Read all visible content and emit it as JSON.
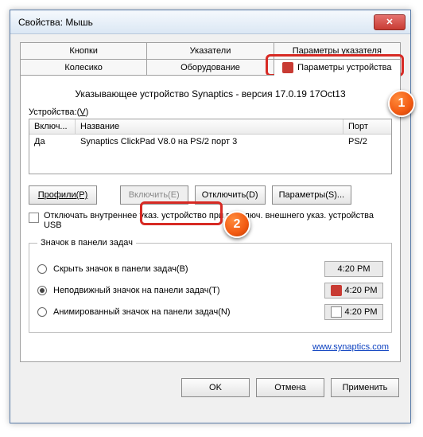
{
  "window": {
    "title": "Свойства: Мышь"
  },
  "tabs": {
    "row1": [
      "Кнопки",
      "Указатели",
      "Параметры указателя"
    ],
    "row2": [
      "Колесико",
      "Оборудование",
      "Параметры устройства"
    ]
  },
  "header": "Указывающее устройство Synaptics - версия 17.0.19 17Oct13",
  "devices_label": "Устройства:(V)",
  "grid": {
    "headers": [
      "Включ...",
      "Название",
      "Порт"
    ],
    "row": {
      "enabled": "Да",
      "name": "Synaptics ClickPad V8.0 на PS/2 порт 3",
      "port": "PS/2"
    }
  },
  "buttons": {
    "profiles": "Профили(P)",
    "enable": "Включить(E)",
    "disable": "Отключить(D)",
    "settings": "Параметры(S)..."
  },
  "checkbox": "Отключать внутреннее указ. устройство при подключ. внешнего указ. устройства USB",
  "tray": {
    "legend": "Значок в панели задач",
    "opt1": "Скрыть значок в панели задач(B)",
    "opt2": "Неподвижный значок на панели задач(T)",
    "opt3": "Анимированный значок на панели задач(N)",
    "time": "4:20 PM"
  },
  "link": "www.synaptics.com",
  "bottom": {
    "ok": "OK",
    "cancel": "Отмена",
    "apply": "Применить"
  },
  "callouts": {
    "c1": "1",
    "c2": "2"
  }
}
